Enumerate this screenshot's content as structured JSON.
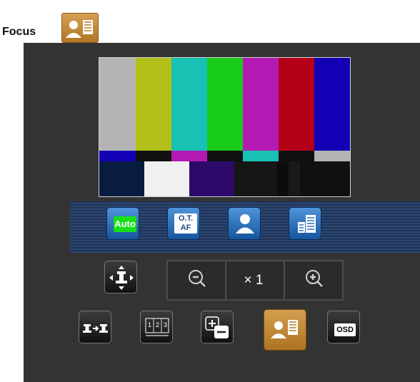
{
  "heading": {
    "title": "Focus"
  },
  "controls": {
    "auto_label": "Auto",
    "otaf_label_line1": "O.T.",
    "otaf_label_line2": "AF",
    "zoom_factor": "× 1",
    "osd_label": "OSD"
  },
  "colors": {
    "panel_bg": "#333333",
    "mode_strip": "#2c4773",
    "mode_button": "#2e7ac7",
    "auto_green": "#18e018",
    "active_gold": "#c88a35",
    "color_bars_top": [
      "#b4b4b4",
      "#b4c01a",
      "#19c0b4",
      "#1acc1a",
      "#b31ab4",
      "#b40019",
      "#1400b4"
    ],
    "color_bars_middle": [
      "#1400b4",
      "#101010",
      "#b31ab4",
      "#101010",
      "#19c0b4",
      "#101010",
      "#b4b4b4"
    ],
    "color_bars_bottom": [
      "#081c3f",
      "#f0f0f0",
      "#2d0a6a",
      "#161616",
      "#0c0c0c",
      "#191919",
      "#101010"
    ]
  },
  "icons": [
    "focus-person-icon",
    "auto-icon",
    "one-touch-af-icon",
    "person-icon",
    "building-icon",
    "pan-tilt-icon",
    "zoom-out-icon",
    "zoom-in-icon",
    "position-switch-icon",
    "preset-numbers-icon",
    "plus-minus-icon",
    "osd-icon"
  ]
}
